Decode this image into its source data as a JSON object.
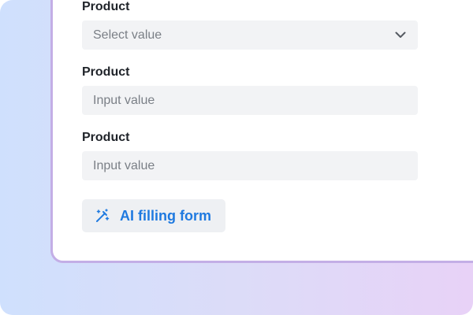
{
  "form": {
    "fields": [
      {
        "label": "Product",
        "type": "select",
        "placeholder": "Select value"
      },
      {
        "label": "Product",
        "type": "input",
        "placeholder": "Input value"
      },
      {
        "label": "Product",
        "type": "input",
        "placeholder": "Input value"
      }
    ],
    "ai_button_label": "AI filling form",
    "ai_button_icon": "magic-wand-icon",
    "select_icon": "chevron-down-icon"
  },
  "colors": {
    "accent": "#1f7ae0",
    "card_border": "#c3aee6",
    "field_bg": "#f2f3f5"
  }
}
